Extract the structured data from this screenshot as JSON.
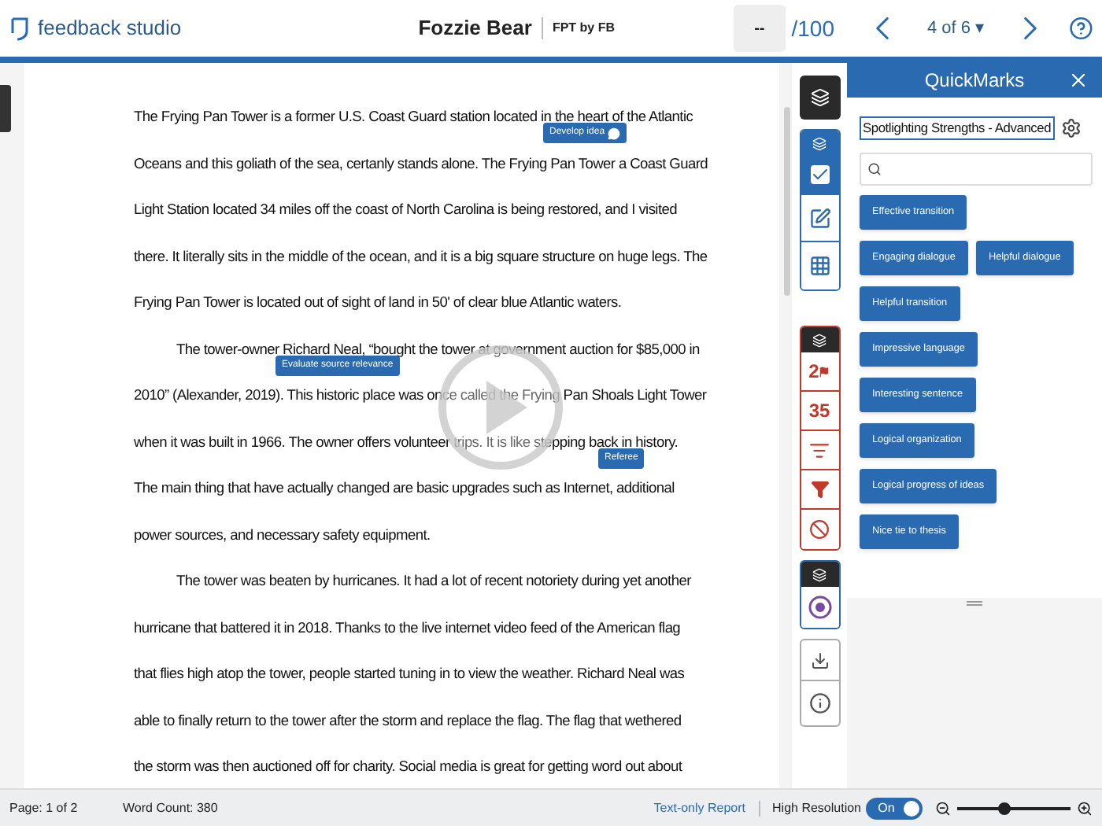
{
  "header": {
    "brand": "feedback studio",
    "student": "Fozzie Bear",
    "assignment": "FPT by FB",
    "grade_value": "--",
    "grade_total": "/100",
    "pager": "4 of 6",
    "pager_caret": "▾"
  },
  "document": {
    "paragraphs": [
      {
        "indent": false,
        "lines": [
          "The Frying Pan Tower is a former U.S. Coast Guard station located in the heart of the Atlantic",
          "Oceans and this goliath of the sea, certanly stands alone. The Frying Pan Tower a Coast Guard",
          "Light Station located 34 miles off the coast of North Carolina is being restored, and I visited",
          "there. It literally sits in the middle of the ocean, and it is a big square structure on huge legs. The",
          "Frying Pan Tower is located out of sight of land in 50' of clear blue Atlantic waters."
        ]
      },
      {
        "indent": true,
        "lines": [
          "The tower-owner Richard Neal, “bought the tower at government auction for $85,000 in",
          "2010” (Alexander, 2019). This historic place was once called the Frying Pan Shoals Light Tower",
          "when it was built in 1966. The owner offers volunteer trips. It is like stepping back in history.",
          "The main thing that have actually changed are basic upgrades such as Internet, additional",
          "power sources, and necessary safety equipment."
        ]
      },
      {
        "indent": true,
        "lines": [
          "The tower was beaten by hurricanes. It had a lot of recent notoriety during yet another",
          "hurricane that battered it in 2018. Thanks to the live internet video feed of the American flag",
          "that flies high atop the tower, people started tuning in to view the weather. Richard Neal was",
          "able to finally return to the tower after the storm and replace the flag. The flag that wethered",
          "the storm was then auctioned off for charity. Social media is great for getting word out about"
        ]
      }
    ],
    "annotations": [
      {
        "label": "Develop idea",
        "has_comment": true
      },
      {
        "label": "Evaluate source relevance",
        "has_comment": false
      },
      {
        "label": "Referee",
        "has_comment": false
      }
    ]
  },
  "toolbar": {
    "flag_count": "2",
    "similarity": "35",
    "checklist_selected": true
  },
  "quickmarks": {
    "title": "QuickMarks",
    "set": "Spotlighting Strengths - Advanced",
    "marks": [
      "Effective transition",
      "Engaging dialogue",
      "Helpful dialogue",
      "Helpful transition",
      "Impressive language",
      "Interesting sentence",
      "Logical organization",
      "Logical progress of ideas",
      "Nice tie to thesis"
    ]
  },
  "status_bar": {
    "page": "Page: 1 of 2",
    "word_count": "Word Count: 380",
    "report_link": "Text-only Report",
    "high_resolution": {
      "label": "High Resolution",
      "on": true,
      "on_text": "On"
    },
    "zoom": {
      "level": 0.42
    }
  }
}
